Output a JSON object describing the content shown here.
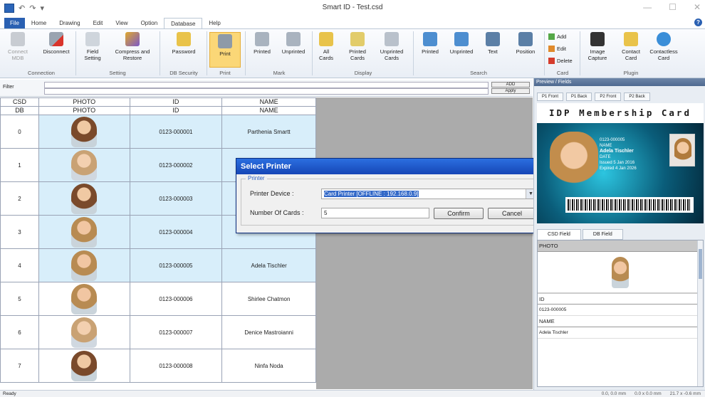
{
  "window": {
    "title": "Smart ID - Test.csd"
  },
  "menu_tabs": [
    "File",
    "Home",
    "Drawing",
    "Edit",
    "View",
    "Option",
    "Database",
    "Help"
  ],
  "ribbon": {
    "connection": {
      "label": "Connection",
      "buttons": [
        "Connect MDB",
        "Disconnect"
      ]
    },
    "setting": {
      "label": "Setting",
      "buttons": [
        "Field Setting",
        "Compress and Restore"
      ]
    },
    "db_security": {
      "label": "DB Security",
      "buttons": [
        "Password"
      ]
    },
    "print": {
      "label": "Print",
      "buttons": [
        "Print"
      ]
    },
    "mark": {
      "label": "Mark",
      "buttons": [
        "Printed",
        "Unprinted"
      ]
    },
    "display": {
      "label": "Display",
      "buttons": [
        "All Cards",
        "Printed Cards",
        "Unprinted Cards"
      ]
    },
    "search": {
      "label": "Search",
      "buttons": [
        "Printed",
        "Unprinted",
        "Text",
        "Position"
      ]
    },
    "card": {
      "label": "Card",
      "buttons": [
        "Add",
        "Edit",
        "Delete"
      ]
    },
    "plugin": {
      "label": "Plugin",
      "buttons": [
        "Image Capture",
        "Contact Card",
        "Contactless Card"
      ]
    }
  },
  "filter": {
    "label": "Filter",
    "add_label": "ADD",
    "apply_label": "Apply"
  },
  "table": {
    "header_rows": [
      [
        "CSD",
        "PHOTO",
        "ID",
        "NAME"
      ],
      [
        "DB",
        "PHOTO",
        "ID",
        "NAME"
      ]
    ],
    "rows": [
      {
        "idx": "0",
        "id": "0123-000001",
        "name": "Parthenia Smartt"
      },
      {
        "idx": "1",
        "id": "0123-000002",
        "name": ""
      },
      {
        "idx": "2",
        "id": "0123-000003",
        "name": ""
      },
      {
        "idx": "3",
        "id": "0123-000004",
        "name": ""
      },
      {
        "idx": "4",
        "id": "0123-000005",
        "name": "Adela Tischler"
      },
      {
        "idx": "5",
        "id": "0123-000006",
        "name": "Shirlee Chatmon"
      },
      {
        "idx": "6",
        "id": "0123-000007",
        "name": "Denice Mastroianni"
      },
      {
        "idx": "7",
        "id": "0123-000008",
        "name": "Ninfa Noda"
      }
    ]
  },
  "dialog": {
    "title": "Select Printer",
    "group": "Printer",
    "device_label": "Printer Device :",
    "device_value": "Card Printer  [OFFLINE : 192.168.0.9]",
    "count_label": "Number Of Cards :",
    "count_value": "5",
    "confirm": "Confirm",
    "cancel": "Cancel"
  },
  "preview": {
    "title": "Preview / Fields",
    "tabs": [
      "P1 Front",
      "P1 Back",
      "P2 Front",
      "P2 Back"
    ],
    "card_header": "IDP Membership Card",
    "card_id": "0123-000005",
    "card_name_label": "NAME",
    "card_name": "Adela Tischler",
    "card_date_label": "DATE",
    "issued": "Issued 5 Jan 2016",
    "expired": "Expired 4 Jan 2026",
    "field_tabs": [
      "CSD Field",
      "DB Field"
    ],
    "fields": [
      {
        "name": "PHOTO",
        "value": ""
      },
      {
        "name": "ID",
        "value": "0123-000005"
      },
      {
        "name": "NAME",
        "value": "Adela Tischler"
      }
    ]
  },
  "status": {
    "left": "Ready",
    "pos1": "0.0, 0.0 mm",
    "pos2": "0.0 x 0.0 mm",
    "pos3": "21.7 x -0.6 mm"
  }
}
